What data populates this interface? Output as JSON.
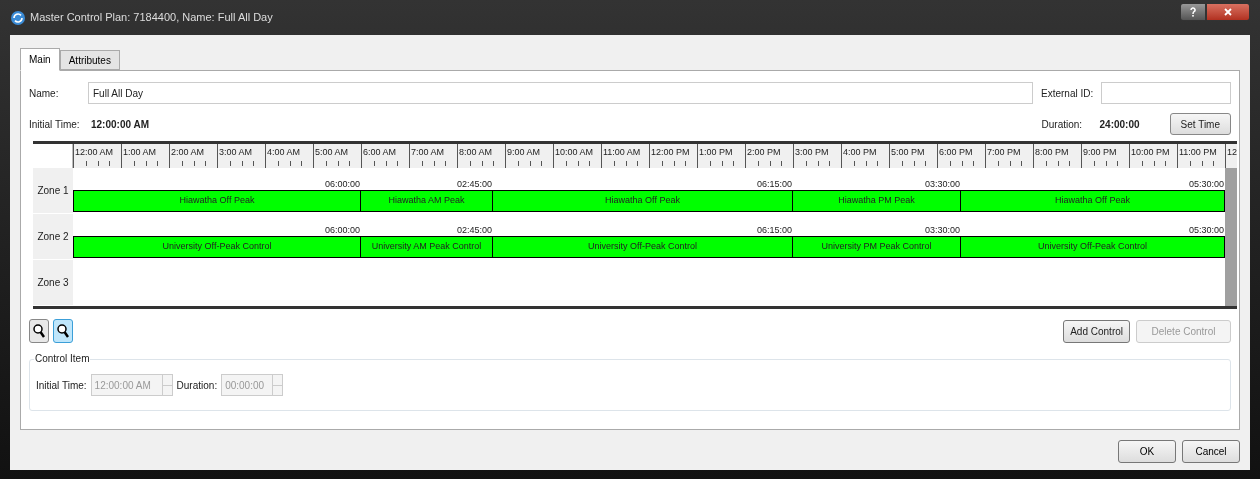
{
  "window": {
    "title": "Master Control Plan: 7184400, Name: Full All Day"
  },
  "tabs": [
    {
      "label": "Main",
      "selected": true
    },
    {
      "label": "Attributes",
      "selected": false
    }
  ],
  "name_field": {
    "label": "Name:",
    "value": "Full All Day"
  },
  "external_id_field": {
    "label": "External ID:"
  },
  "initial_time": {
    "label": "Initial Time:",
    "value": "12:00:00 AM"
  },
  "duration": {
    "label": "Duration:",
    "value": "24:00:00"
  },
  "set_time_button": "Set Time",
  "timeline": {
    "hours": [
      "12:00 AM",
      "1:00 AM",
      "2:00 AM",
      "3:00 AM",
      "4:00 AM",
      "5:00 AM",
      "6:00 AM",
      "7:00 AM",
      "8:00 AM",
      "9:00 AM",
      "10:00 AM",
      "11:00 AM",
      "12:00 PM",
      "1:00 PM",
      "2:00 PM",
      "3:00 PM",
      "4:00 PM",
      "5:00 PM",
      "6:00 PM",
      "7:00 PM",
      "8:00 PM",
      "9:00 PM",
      "10:00 PM",
      "11:00 PM",
      "12"
    ],
    "zones": [
      {
        "label": "Zone 1",
        "controls": [
          {
            "name": "Hiawatha Off Peak",
            "duration": "06:00:00"
          },
          {
            "name": "Hiawatha AM Peak",
            "duration": "02:45:00"
          },
          {
            "name": "Hiawatha Off Peak",
            "duration": "06:15:00"
          },
          {
            "name": "Hiawatha PM Peak",
            "duration": "03:30:00"
          },
          {
            "name": "Hiawatha Off Peak",
            "duration": "05:30:00"
          }
        ]
      },
      {
        "label": "Zone 2",
        "controls": [
          {
            "name": "University Off-Peak Control",
            "duration": "06:00:00"
          },
          {
            "name": "University AM Peak Control",
            "duration": "02:45:00"
          },
          {
            "name": "University Off-Peak Control",
            "duration": "06:15:00"
          },
          {
            "name": "University PM Peak Control",
            "duration": "03:30:00"
          },
          {
            "name": "University Off-Peak Control",
            "duration": "05:30:00"
          }
        ]
      },
      {
        "label": "Zone 3"
      }
    ]
  },
  "zoom_buttons": [
    {
      "selected": false
    },
    {
      "selected": true
    }
  ],
  "add_control_button": {
    "label": "Add Control",
    "disabled": false
  },
  "delete_control_button": {
    "label": "Delete Control",
    "disabled": true
  },
  "control_item": {
    "title": "Control Item",
    "initial_time": {
      "label": "Initial Time:",
      "value": "12:00:00 AM",
      "disabled": true
    },
    "duration": {
      "label": "Duration:",
      "value": "00:00:00",
      "disabled": true
    }
  },
  "buttons": [
    "OK",
    "Cancel"
  ]
}
